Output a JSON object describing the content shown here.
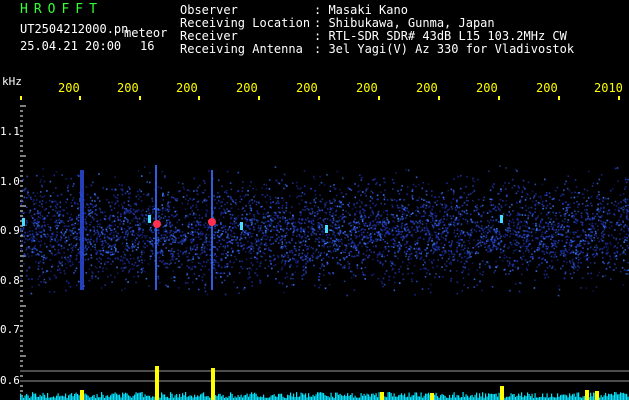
{
  "header": {
    "app_name": "HROFFT",
    "file_name": "UT2504212000.pn",
    "date_time": "25.04.21 20:00",
    "mode_label": "meteor",
    "count": "16",
    "fields": [
      {
        "label": "Observer",
        "value": ": Masaki Kano"
      },
      {
        "label": "Receiving Location",
        "value": ": Shibukawa, Gunma, Japan"
      },
      {
        "label": "Receiver",
        "value": ": RTL-SDR SDR# 43dB L15 103.2MHz CW"
      },
      {
        "label": "Receiving Antenna",
        "value": ": 3el Yagi(V) Az 330 for Vladivostok"
      }
    ]
  },
  "axis": {
    "unit": "kHz",
    "y_ticks": [
      "1.1",
      "1.0",
      "0.9",
      "0.8",
      "0.7",
      "0.6"
    ],
    "x_ticks": [
      "200",
      "200",
      "200",
      "200",
      "200",
      "200",
      "200",
      "200",
      "200",
      "2010"
    ]
  },
  "colors": {
    "background": "#000000",
    "signal_low": "#1a2a9a",
    "signal_mid": "#3a7bff",
    "signal_high": "#ff3050",
    "level_bar": "#00e5ff",
    "peak_bar": "#ffff00",
    "axis_text": "#ffff00"
  }
}
